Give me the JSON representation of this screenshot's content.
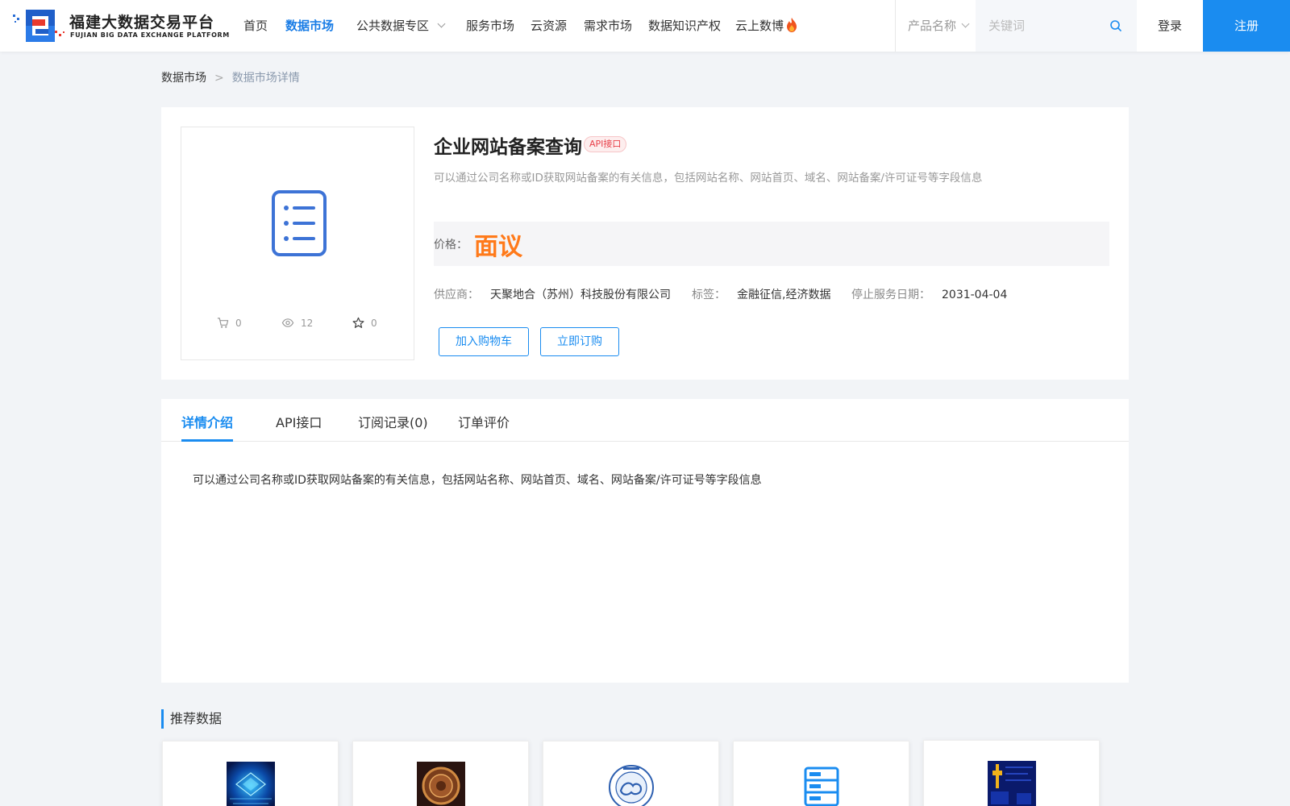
{
  "header": {
    "logo_cn": "福建大数据交易平台",
    "logo_en": "FUJIAN BIG DATA EXCHANGE  PLATFORM",
    "nav": [
      {
        "label": "首页"
      },
      {
        "label": "数据市场"
      },
      {
        "label": "公共数据专区"
      },
      {
        "label": "服务市场"
      },
      {
        "label": "云资源"
      },
      {
        "label": "需求市场"
      },
      {
        "label": "数据知识产权"
      },
      {
        "label": "云上数博"
      }
    ],
    "active_nav": "数据市场",
    "search": {
      "category": "产品名称",
      "placeholder": "关键词",
      "value": ""
    },
    "login": "登录",
    "register": "注册"
  },
  "breadcrumb": {
    "items": [
      "数据市场",
      "数据市场详情"
    ],
    "separator": ">"
  },
  "product": {
    "title": "企业网站备案查询",
    "badge": "API接口",
    "description": "可以通过公司名称或ID获取网站备案的有关信息，包括网站名称、网站首页、域名、网站备案/许可证号等字段信息",
    "stats": {
      "cart": "0",
      "views": "12",
      "favorites": "0"
    },
    "price_label": "价格：",
    "price": "面议",
    "meta": {
      "supplier_label": "供应商：",
      "supplier": "天聚地合（苏州）科技股份有限公司",
      "tags_label": "标签：",
      "tags": "金融征信,经济数据",
      "stop_date_label": "停止服务日期：",
      "stop_date": "2031-04-04"
    },
    "add_to_cart": "加入购物车",
    "buy_now": "立即订购"
  },
  "detail": {
    "tabs": [
      {
        "label": "详情介绍"
      },
      {
        "label": "API接口"
      },
      {
        "label": "订阅记录(0)"
      },
      {
        "label": "订单评价"
      }
    ],
    "active_tab": "详情介绍",
    "content": "可以通过公司名称或ID获取网站备案的有关信息，包括网站名称、网站首页、域名、网站备案/许可证号等字段信息"
  },
  "recommend": {
    "title": "推荐数据",
    "cards": [
      {
        "image": "blue-chip-image"
      },
      {
        "image": "bronze-coin-image"
      },
      {
        "image": "weather-bureau-seal-image"
      },
      {
        "image": "server-stack-icon"
      },
      {
        "image": "dark-chart-image"
      }
    ]
  },
  "colors": {
    "accent": "#1a8cf0",
    "price": "#ff7a1a",
    "badge": "#e8414a"
  }
}
